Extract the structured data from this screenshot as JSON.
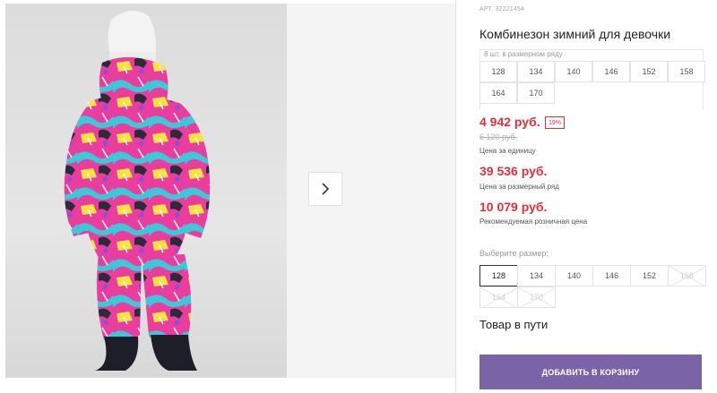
{
  "product": {
    "sku": "АРТ. 32221454",
    "title": "Комбинезон зимний для девочки"
  },
  "row_sizes": {
    "hint": "8 шт. в размерном ряду",
    "sizes": [
      "128",
      "134",
      "140",
      "146",
      "152",
      "158",
      "164",
      "170"
    ]
  },
  "prices": {
    "unit_price": "4 942 руб.",
    "discount": "19%",
    "old_price": "6 120 руб.",
    "unit_label": "Цена за единицу",
    "row_price": "39 536 руб.",
    "row_label": "Цена за размерный ряд",
    "retail_price": "10 079 руб.",
    "retail_label": "Рекомендуемая розничная цена",
    "accent_color": "#e0313a"
  },
  "size_picker": {
    "label": "Выберите размер:",
    "options": [
      {
        "size": "128",
        "state": "selected"
      },
      {
        "size": "134",
        "state": "available"
      },
      {
        "size": "140",
        "state": "available"
      },
      {
        "size": "146",
        "state": "available"
      },
      {
        "size": "152",
        "state": "available"
      },
      {
        "size": "158",
        "state": "unavailable"
      },
      {
        "size": "164",
        "state": "unavailable"
      },
      {
        "size": "170",
        "state": "unavailable"
      }
    ]
  },
  "status": "Товар в пути",
  "cart_button": {
    "label": "ДОБАВИТЬ В КОРЗИНУ",
    "color": "#7b63a8"
  },
  "gallery": {
    "next_icon": "chevron-right-icon",
    "photo_subject": "product-photo"
  }
}
